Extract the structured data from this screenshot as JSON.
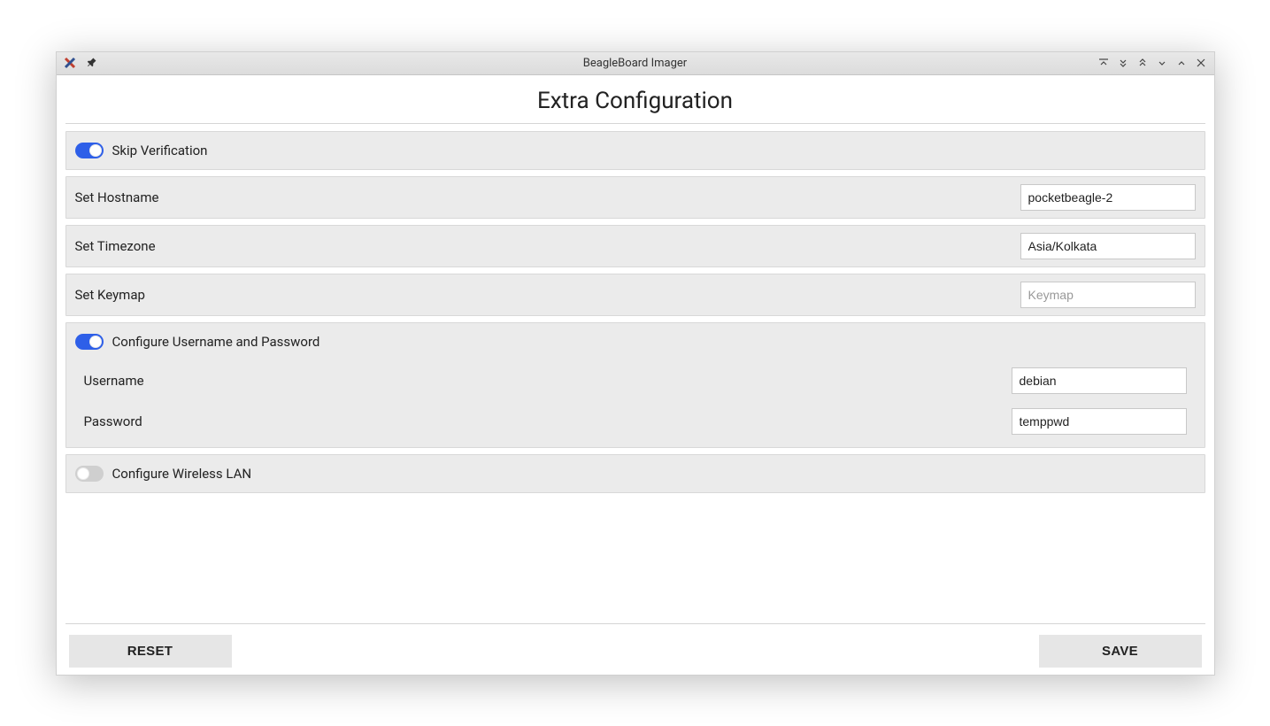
{
  "window": {
    "title": "BeagleBoard Imager"
  },
  "header": {
    "title": "Extra Configuration"
  },
  "skip": {
    "label": "Skip Verification"
  },
  "hostname": {
    "label": "Set Hostname",
    "value": "pocketbeagle-2"
  },
  "timezone": {
    "label": "Set Timezone",
    "value": "Asia/Kolkata"
  },
  "keymap": {
    "label": "Set Keymap",
    "placeholder": "Keymap",
    "value": ""
  },
  "userpass": {
    "label": "Configure Username and Password",
    "username_label": "Username",
    "username_value": "debian",
    "password_label": "Password",
    "password_value": "temppwd"
  },
  "wlan": {
    "label": "Configure Wireless LAN"
  },
  "footer": {
    "reset": "RESET",
    "save": "SAVE"
  }
}
